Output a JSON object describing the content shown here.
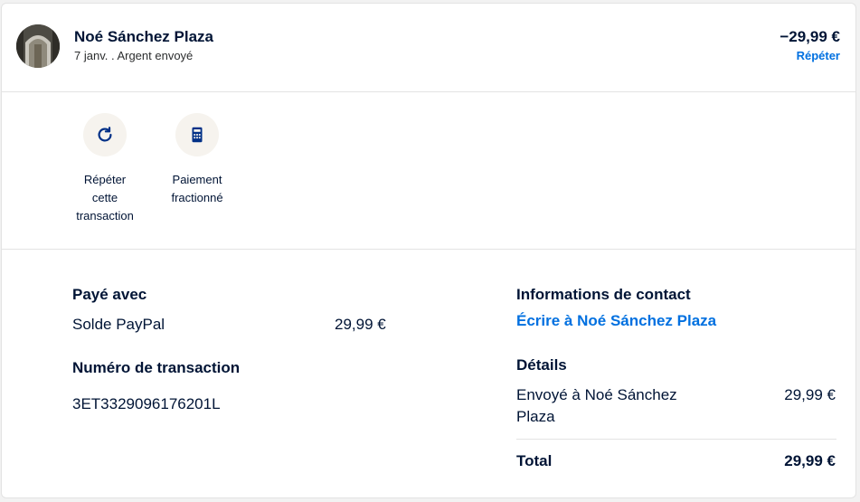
{
  "header": {
    "name": "Noé Sánchez Plaza",
    "subline": "7 janv. . Argent envoyé",
    "amount": "−29,99 €",
    "repeat_link": "Répéter"
  },
  "actions": [
    {
      "label_lines": [
        "Répéter",
        "cette",
        "transaction"
      ],
      "icon": "refresh-icon"
    },
    {
      "label_lines": [
        "Paiement",
        "fractionné"
      ],
      "icon": "calculator-icon"
    }
  ],
  "payment": {
    "heading": "Payé avec",
    "method": "Solde PayPal",
    "amount": "29,99 €"
  },
  "transaction": {
    "heading": "Numéro de transaction",
    "id": "3ET3329096176201L"
  },
  "contact": {
    "heading": "Informations de contact",
    "link": "Écrire à Noé Sánchez Plaza"
  },
  "summary": {
    "heading": "Détails",
    "line_label_1": "Envoyé à Noé Sánchez",
    "line_label_2": "Plaza",
    "line_amount": "29,99 €",
    "total_label": "Total",
    "total_amount": "29,99 €"
  },
  "colors": {
    "text": "#001435",
    "link": "#0070e0",
    "icon_bg": "#f6f3ee",
    "divider": "#e3e3e3"
  }
}
